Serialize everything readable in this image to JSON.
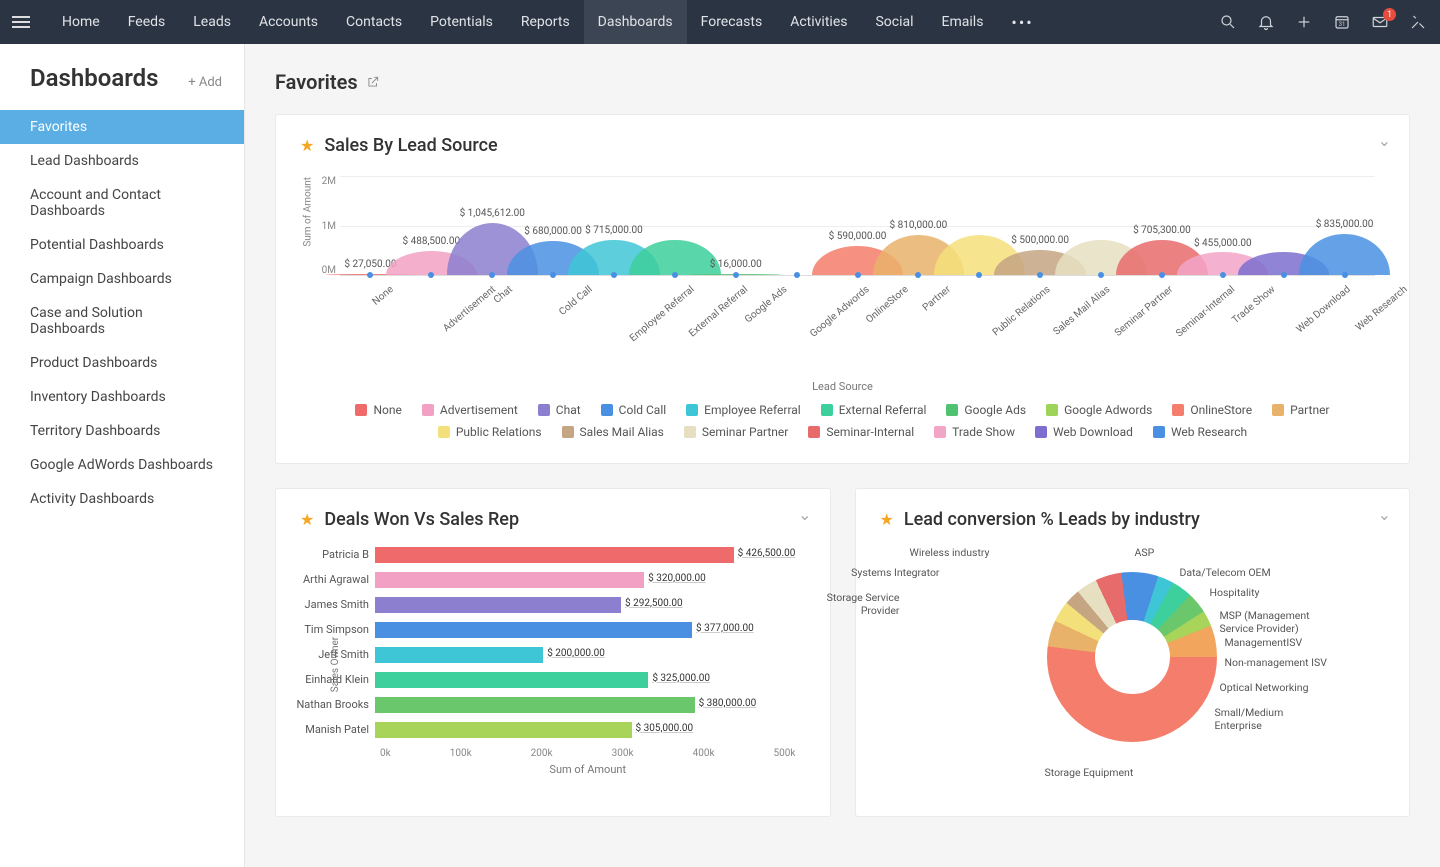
{
  "nav": {
    "items": [
      "Home",
      "Feeds",
      "Leads",
      "Accounts",
      "Contacts",
      "Potentials",
      "Reports",
      "Dashboards",
      "Forecasts",
      "Activities",
      "Social",
      "Emails"
    ],
    "active": "Dashboards",
    "mail_badge": "1"
  },
  "sidebar": {
    "title": "Dashboards",
    "add_label": "+ Add",
    "items": [
      "Favorites",
      "Lead Dashboards",
      "Account and Contact Dashboards",
      "Potential Dashboards",
      "Campaign Dashboards",
      "Case and Solution Dashboards",
      "Product Dashboards",
      "Inventory Dashboards",
      "Territory Dashboards",
      "Google AdWords Dashboards",
      "Activity Dashboards"
    ],
    "active": "Favorites"
  },
  "page": {
    "title": "Favorites"
  },
  "cards": {
    "lead_source": {
      "title": "Sales By Lead Source"
    },
    "deals_won": {
      "title": "Deals Won Vs Sales Rep"
    },
    "lead_conv": {
      "title": "Lead conversion % Leads by industry"
    }
  },
  "chart_data": [
    {
      "id": "lead_source",
      "type": "area",
      "ylabel": "Sum of Amount",
      "xlabel": "Lead Source",
      "y_ticks": [
        "2M",
        "1M",
        "0M"
      ],
      "ylim": [
        0,
        2000000
      ],
      "series": [
        {
          "name": "None",
          "value": 27050,
          "label": "$ 27,050.00",
          "color": "#ef6a6a"
        },
        {
          "name": "Advertisement",
          "value": 488500,
          "label": "$ 488,500.00",
          "color": "#f2a1c4"
        },
        {
          "name": "Chat",
          "value": 1045612,
          "label": "$ 1,045,612.00",
          "color": "#8d7fd0"
        },
        {
          "name": "Cold Call",
          "value": 680000,
          "label": "$ 680,000.00",
          "color": "#4a90e2"
        },
        {
          "name": "Employee Referral",
          "value": 715000,
          "label": "$ 715,000.00",
          "color": "#3fc6d6"
        },
        {
          "name": "External Referral",
          "value": 715000,
          "label": "",
          "color": "#3dcf9c"
        },
        {
          "name": "Google Ads",
          "value": 16000,
          "label": "$ 16,000.00",
          "color": "#4fc36f"
        },
        {
          "name": "Google Adwords",
          "value": 0,
          "label": "",
          "color": "#9ed45a"
        },
        {
          "name": "OnlineStore",
          "value": 590000,
          "label": "$ 590,000.00",
          "color": "#f47d6b"
        },
        {
          "name": "Partner",
          "value": 810000,
          "label": "$ 810,000.00",
          "color": "#e9b26a"
        },
        {
          "name": "Public Relations",
          "value": 810000,
          "label": "",
          "color": "#f4e07a"
        },
        {
          "name": "Sales Mail Alias",
          "value": 500000,
          "label": "$ 500,000.00",
          "color": "#c6a583"
        },
        {
          "name": "Seminar Partner",
          "value": 705300,
          "label": "",
          "color": "#e6dfc2"
        },
        {
          "name": "Seminar-Internal",
          "value": 705300,
          "label": "$ 705,300.00",
          "color": "#e86b6b"
        },
        {
          "name": "Trade Show",
          "value": 455000,
          "label": "$ 455,000.00",
          "color": "#f3a5c8"
        },
        {
          "name": "Web Download",
          "value": 455000,
          "label": "",
          "color": "#7d6fcf"
        },
        {
          "name": "Web Research",
          "value": 835000,
          "label": "$ 835,000.00",
          "color": "#4a90e2"
        }
      ]
    },
    {
      "id": "deals_won",
      "type": "bar",
      "orientation": "horizontal",
      "ylabel": "Sales Owner",
      "xlabel": "Sum of Amount",
      "xlim": [
        0,
        500000
      ],
      "x_ticks": [
        "0k",
        "100k",
        "200k",
        "300k",
        "400k",
        "500k"
      ],
      "series": [
        {
          "name": "Patricia B",
          "value": 426500,
          "label": "$ 426,500.00",
          "color": "#ef6a6a"
        },
        {
          "name": "Arthi Agrawal",
          "value": 320000,
          "label": "$ 320,000.00",
          "color": "#f2a1c4"
        },
        {
          "name": "James Smith",
          "value": 292500,
          "label": "$ 292,500.00",
          "color": "#8d7fd0"
        },
        {
          "name": "Tim Simpson",
          "value": 377000,
          "label": "$ 377,000.00",
          "color": "#4a90e2"
        },
        {
          "name": "Jeff Smith",
          "value": 200000,
          "label": "$ 200,000.00",
          "color": "#3fc6d6"
        },
        {
          "name": "Einhard Klein",
          "value": 325000,
          "label": "$ 325,000.00",
          "color": "#3dcf9c"
        },
        {
          "name": "Nathan Brooks",
          "value": 380000,
          "label": "$ 380,000.00",
          "color": "#6bc76b"
        },
        {
          "name": "Manish Patel",
          "value": 305000,
          "label": "$ 305,000.00",
          "color": "#a8d45a"
        }
      ]
    },
    {
      "id": "lead_conv",
      "type": "pie",
      "series": [
        {
          "name": "Storage Equipment",
          "value": 52,
          "color": "#f47d6b"
        },
        {
          "name": "Storage Service Provider",
          "value": 5,
          "color": "#e9b26a"
        },
        {
          "name": "Systems Integrator",
          "value": 4,
          "color": "#f4e07a"
        },
        {
          "name": "Wireless industry",
          "value": 3,
          "color": "#c6a583"
        },
        {
          "name": "ASP",
          "value": 4,
          "color": "#e6dfc2"
        },
        {
          "name": "Data/Telecom OEM",
          "value": 5,
          "color": "#e86b6b"
        },
        {
          "name": "Hospitality",
          "value": 7,
          "color": "#4a90e2"
        },
        {
          "name": "MSP (Management Service Provider)",
          "value": 3,
          "color": "#3fc6d6"
        },
        {
          "name": "ManagementISV",
          "value": 4,
          "color": "#3dcf9c"
        },
        {
          "name": "Non-management ISV",
          "value": 4,
          "color": "#6bc76b"
        },
        {
          "name": "Optical Networking",
          "value": 3,
          "color": "#a8d45a"
        },
        {
          "name": "Small/Medium Enterprise",
          "value": 6,
          "color": "#f2a55c"
        }
      ]
    }
  ]
}
